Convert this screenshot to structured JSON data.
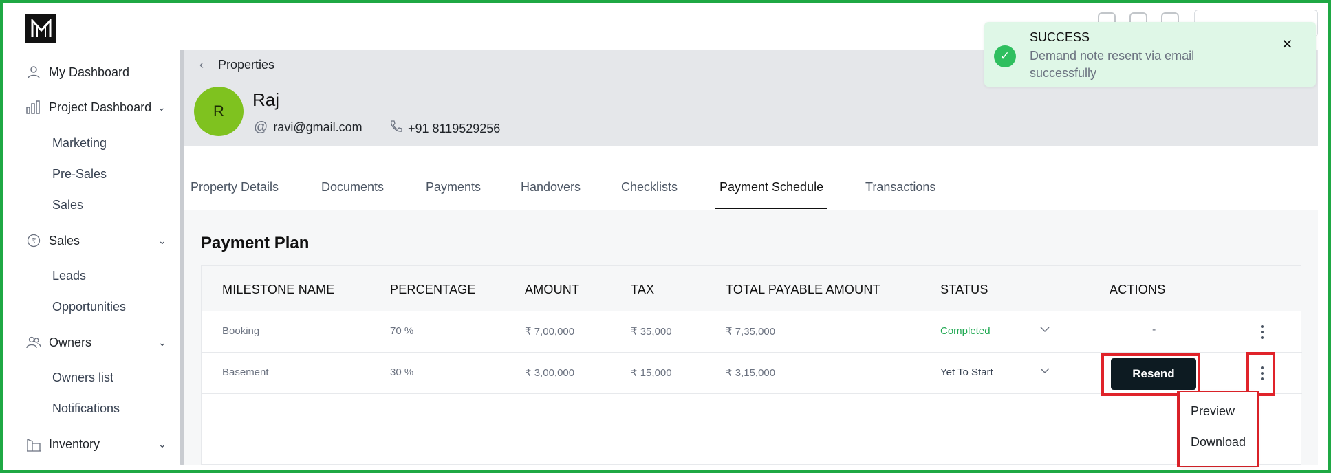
{
  "app": {
    "logo_label": "M"
  },
  "sidebar": {
    "items": [
      {
        "label": "My Dashboard",
        "icon": "user-icon"
      },
      {
        "label": "Project Dashboard",
        "icon": "bar-chart-icon"
      },
      {
        "label": "Marketing"
      },
      {
        "label": "Pre-Sales"
      },
      {
        "label": "Sales"
      },
      {
        "label": "Sales",
        "icon": "rupee-icon"
      },
      {
        "label": "Leads"
      },
      {
        "label": "Opportunities"
      },
      {
        "label": "Owners",
        "icon": "users-icon"
      },
      {
        "label": "Owners list"
      },
      {
        "label": "Notifications"
      },
      {
        "label": "Inventory",
        "icon": "building-icon"
      }
    ]
  },
  "header": {
    "breadcrumb": "Properties",
    "avatar_initial": "R",
    "name": "Raj",
    "email": "ravi@gmail.com",
    "phone": "+91 8119529256"
  },
  "tabs": [
    {
      "label": "Property Details"
    },
    {
      "label": "Documents"
    },
    {
      "label": "Payments"
    },
    {
      "label": "Handovers"
    },
    {
      "label": "Checklists"
    },
    {
      "label": "Payment Schedule",
      "active": true
    },
    {
      "label": "Transactions"
    }
  ],
  "payment_plan": {
    "title": "Payment Plan",
    "columns": [
      "MILESTONE NAME",
      "PERCENTAGE",
      "AMOUNT",
      "TAX",
      "TOTAL PAYABLE AMOUNT",
      "STATUS",
      "ACTIONS"
    ],
    "rows": [
      {
        "milestone": "Booking",
        "percentage": "70 %",
        "amount": "₹ 7,00,000",
        "tax": "₹ 35,000",
        "total": "₹ 7,35,000",
        "status": "Completed",
        "action": "-"
      },
      {
        "milestone": "Basement",
        "percentage": "30 %",
        "amount": "₹ 3,00,000",
        "tax": "₹ 15,000",
        "total": "₹ 3,15,000",
        "status": "Yet To Start",
        "action": "Resend"
      }
    ]
  },
  "row_menu": {
    "items": [
      "Preview",
      "Download"
    ]
  },
  "toast": {
    "title": "SUCCESS",
    "message": "Demand note resent via email successfully",
    "close": "✕"
  },
  "colors": {
    "frame": "#1fa844",
    "avatar": "#7fc21f",
    "status_completed": "#1fa851",
    "button": "#0d1b22",
    "highlight": "#e0232a",
    "toast_bg": "#dff7e7"
  }
}
